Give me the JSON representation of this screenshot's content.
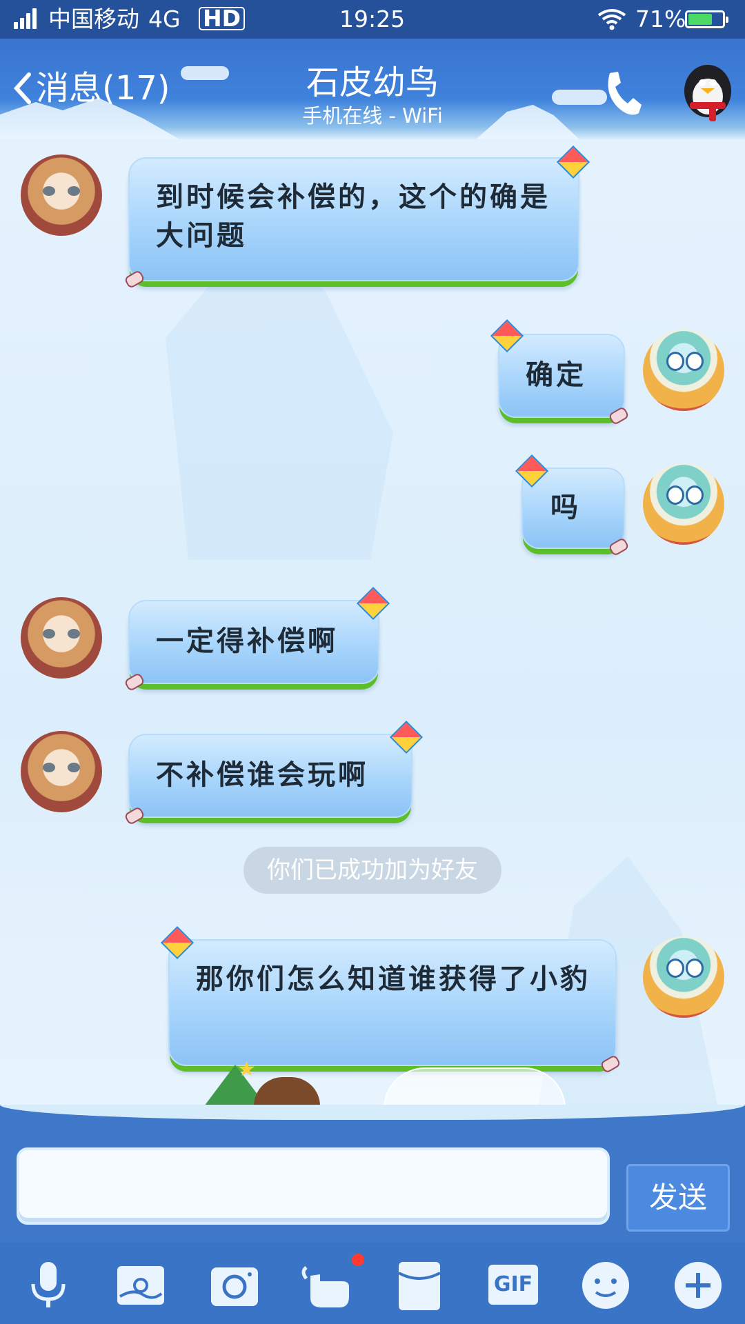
{
  "status_bar": {
    "carrier": "中国移动",
    "network": "4G",
    "hd": "HD",
    "time": "19:25",
    "battery": "71%",
    "battery_level": 0.71
  },
  "header": {
    "back_label": "消息(17)",
    "contact_name": "石皮幼鸟",
    "presence": "手机在线 - WiFi"
  },
  "messages": [
    {
      "side": "left",
      "text": "到时候会补偿的，这个的确是大问题"
    },
    {
      "side": "right",
      "text": "确定"
    },
    {
      "side": "right",
      "text": "吗"
    },
    {
      "side": "left",
      "text": "一定得补偿啊"
    },
    {
      "side": "left",
      "text": "不补偿谁会玩啊"
    },
    {
      "side": "right",
      "text": "那你们怎么知道谁获得了小豹"
    }
  ],
  "system_message": "你们已成功加为好友",
  "input": {
    "value": "",
    "send_label": "发送"
  },
  "toolbar": {
    "icons": [
      "microphone-icon",
      "image-icon",
      "camera-icon",
      "gesture-icon",
      "red-packet-icon",
      "gif-icon",
      "emoji-icon",
      "plus-icon"
    ],
    "gif_label": "GIF"
  },
  "colors": {
    "header_blue": "#3f82dc",
    "status_blue": "#24519a",
    "bubble_blue": "#a8d5fb",
    "grass_green": "#5cbf2a",
    "toolbar_blue": "#3a74c6"
  }
}
